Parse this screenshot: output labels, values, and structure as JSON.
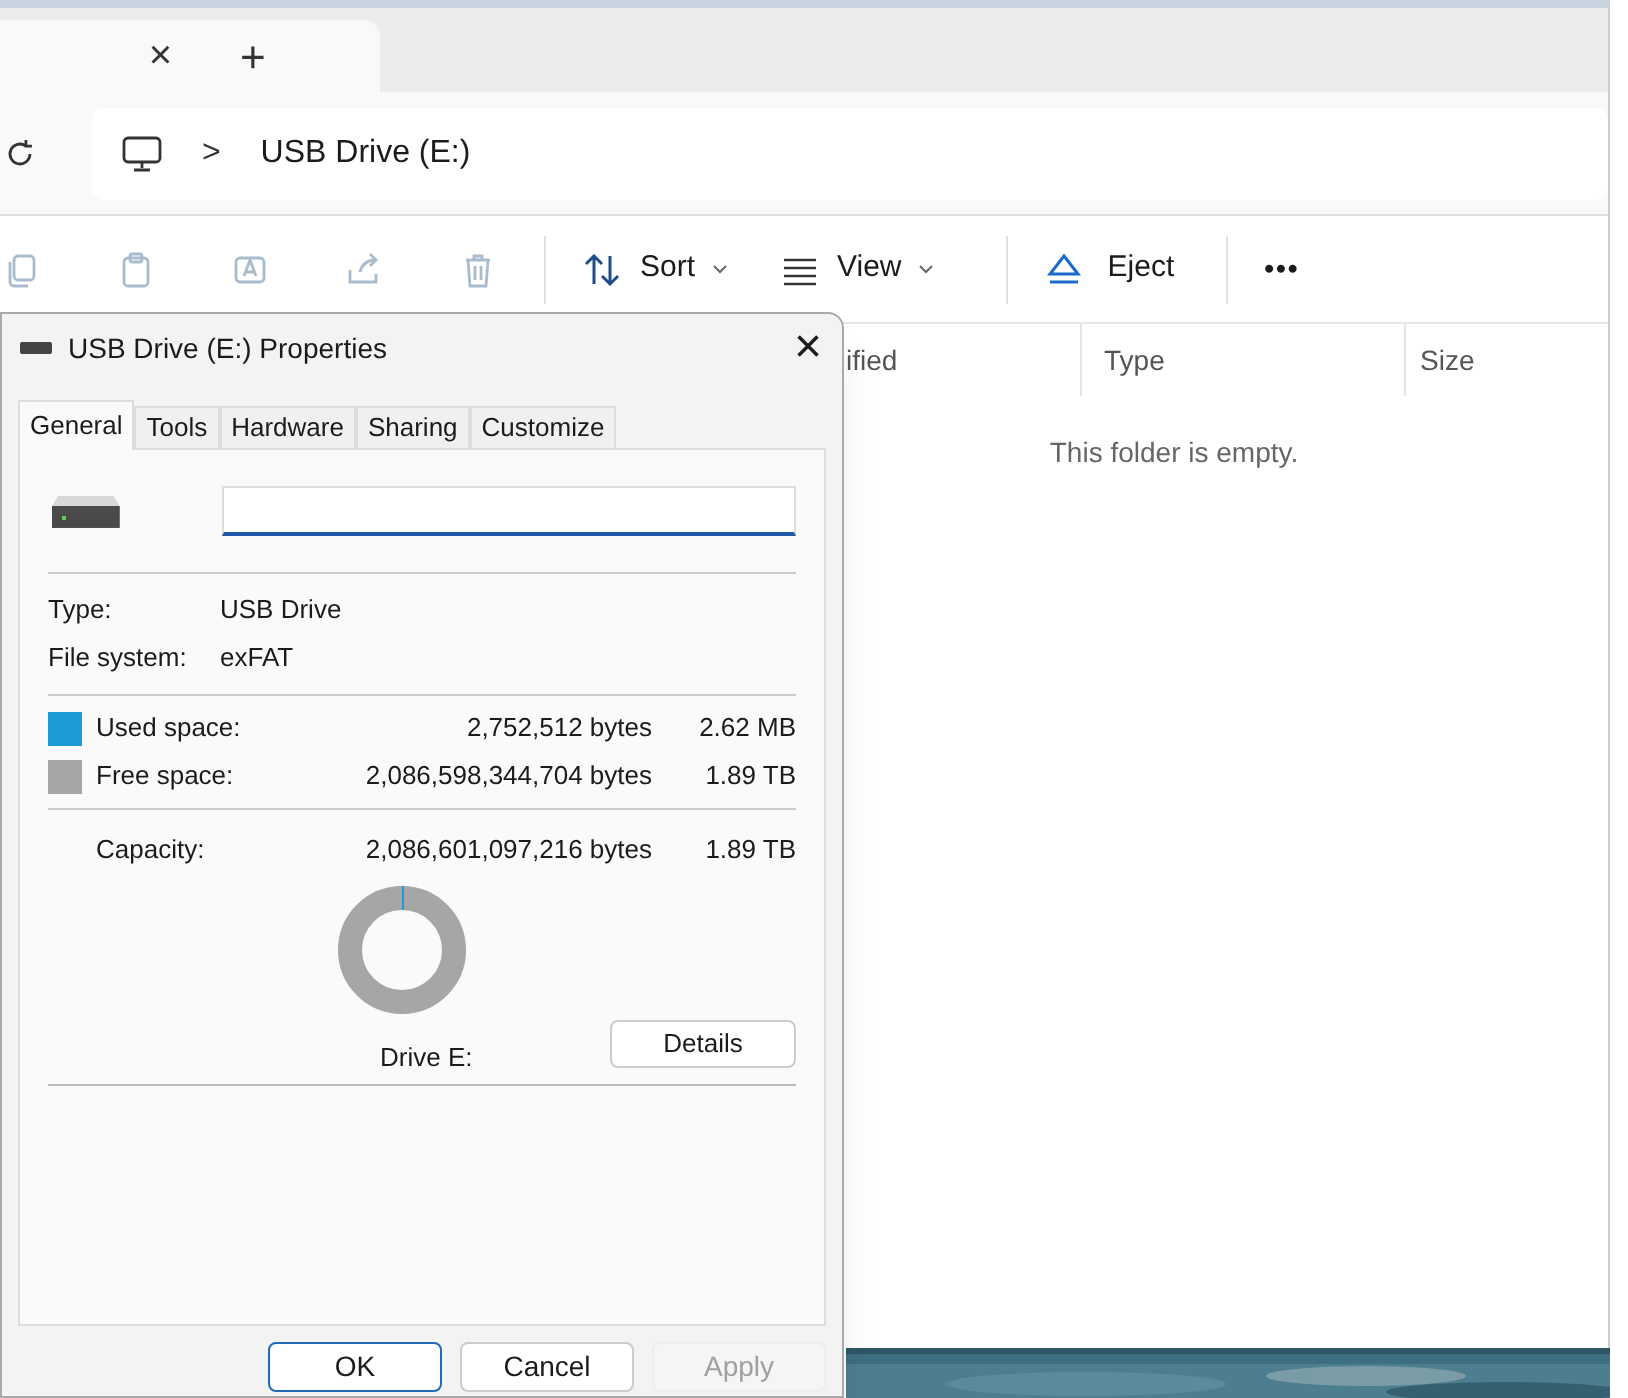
{
  "explorer": {
    "tab": {
      "close": "×"
    },
    "new_tab": "+",
    "breadcrumb": {
      "separator": ">",
      "location": "USB Drive (E:)"
    },
    "toolbar": [
      {
        "kind": "icon",
        "disabled": true
      },
      {
        "kind": "icon",
        "disabled": true
      },
      {
        "kind": "icon",
        "disabled": true
      },
      {
        "kind": "icon",
        "disabled": true
      },
      {
        "kind": "icon",
        "disabled": true
      },
      {
        "kind": "divider"
      },
      {
        "kind": "menu",
        "label": "Sort"
      },
      {
        "kind": "menu",
        "label": "View"
      },
      {
        "kind": "divider"
      },
      {
        "kind": "button",
        "label": "Eject"
      },
      {
        "kind": "divider"
      },
      {
        "kind": "more",
        "label": "•••"
      }
    ],
    "columns": [
      "ified",
      "Type",
      "Size"
    ],
    "empty_message": "This folder is empty."
  },
  "dialog": {
    "title": "USB Drive (E:) Properties",
    "close": "×",
    "tabs": [
      {
        "label": "General",
        "selected": true
      },
      {
        "label": "Tools",
        "selected": false
      },
      {
        "label": "Hardware",
        "selected": false
      },
      {
        "label": "Sharing",
        "selected": false
      },
      {
        "label": "Customize",
        "selected": false
      }
    ],
    "info": [
      {
        "label": "Type:",
        "value": "USB Drive"
      },
      {
        "label": "File system:",
        "value": "exFAT"
      }
    ],
    "space": [
      {
        "label": "Used space:",
        "bytes": "2,752,512 bytes",
        "size": "2.62 MB",
        "color": "#1e9bd7"
      },
      {
        "label": "Free space:",
        "bytes": "2,086,598,344,704 bytes",
        "size": "1.89 TB",
        "color": "#a6a6a6"
      }
    ],
    "capacity": {
      "label": "Capacity:",
      "bytes": "2,086,601,097,216 bytes",
      "size": "1.89 TB"
    },
    "drive_label": "Drive E:",
    "details_button": "Details",
    "buttons": [
      {
        "label": "OK",
        "kind": "default",
        "disabled": false
      },
      {
        "label": "Cancel",
        "kind": "normal",
        "disabled": false
      },
      {
        "label": "Apply",
        "kind": "normal",
        "disabled": true
      }
    ]
  }
}
